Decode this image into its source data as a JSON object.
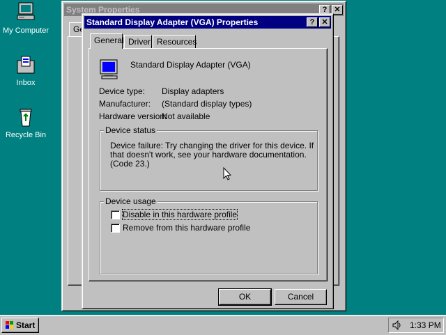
{
  "desktop": {
    "icons": [
      {
        "label": "My Computer",
        "icon": "computer-icon"
      },
      {
        "label": "Inbox",
        "icon": "inbox-icon"
      },
      {
        "label": "Recycle Bin",
        "icon": "recycle-bin-icon"
      }
    ],
    "background_color": "#008080"
  },
  "back_window": {
    "title": "System Properties",
    "tab_partial": "Ge",
    "help_label": "?",
    "close_label": "✕"
  },
  "dialog": {
    "title": "Standard Display Adapter (VGA) Properties",
    "help_label": "?",
    "close_label": "✕",
    "tabs": [
      {
        "label": "General",
        "active": true
      },
      {
        "label": "Driver",
        "active": false
      },
      {
        "label": "Resources",
        "active": false
      }
    ],
    "device_name": "Standard Display Adapter (VGA)",
    "device_icon": "monitor-icon",
    "props": [
      {
        "key": "Device type:",
        "value": "Display adapters"
      },
      {
        "key": "Manufacturer:",
        "value": "(Standard display types)"
      },
      {
        "key": "Hardware version:",
        "value": "Not available"
      }
    ],
    "status_group": {
      "title": "Device status",
      "line1": "Device failure: Try changing the driver for this device. If",
      "line2": "that doesn't work, see your hardware documentation.",
      "line3": "(Code 23.)"
    },
    "usage_group": {
      "title": "Device usage",
      "options": [
        {
          "label": "Disable in this hardware profile",
          "checked": false
        },
        {
          "label": "Remove from this hardware profile",
          "checked": false
        }
      ]
    },
    "ok_label": "OK",
    "cancel_label": "Cancel"
  },
  "taskbar": {
    "start_label": "Start",
    "clock": "1:33 PM",
    "tray_icon": "speaker-icon"
  }
}
